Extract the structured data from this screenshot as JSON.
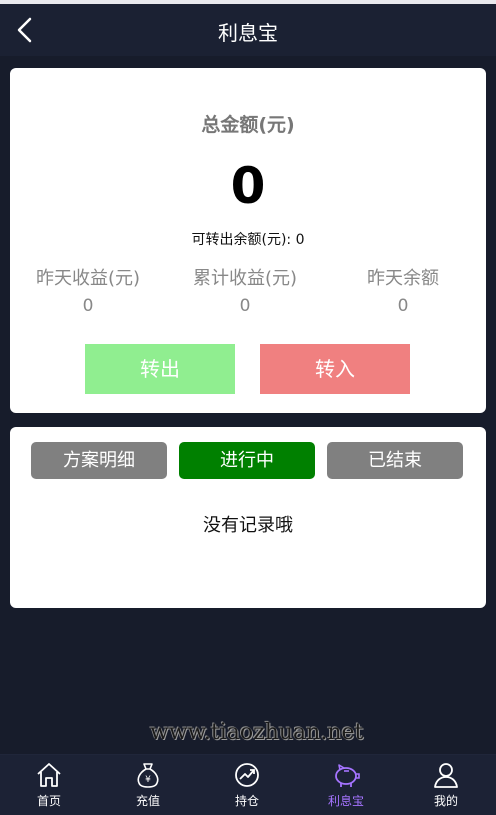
{
  "header": {
    "title": "利息宝"
  },
  "summary": {
    "total_label": "总金额(元)",
    "total_value": "0",
    "transferable_label": "可转出余额(元):",
    "transferable_value": "0",
    "stats": [
      {
        "label": "昨天收益(元)",
        "value": "0"
      },
      {
        "label": "累计收益(元)",
        "value": "0"
      },
      {
        "label": "昨天余额",
        "value": "0"
      }
    ],
    "transfer_out_label": "转出",
    "transfer_in_label": "转入"
  },
  "records": {
    "tabs": [
      {
        "label": "方案明细",
        "color": "#808080"
      },
      {
        "label": "进行中",
        "color": "#008000"
      },
      {
        "label": "已结束",
        "color": "#808080"
      }
    ],
    "empty_message": "没有记录哦"
  },
  "watermark": "www.tiaozhuan.net",
  "tabbar": {
    "items": [
      {
        "label": "首页",
        "icon": "home-icon"
      },
      {
        "label": "充值",
        "icon": "money-bag-icon"
      },
      {
        "label": "持仓",
        "icon": "chart-icon"
      },
      {
        "label": "利息宝",
        "icon": "piggy-bank-icon",
        "active": true
      },
      {
        "label": "我的",
        "icon": "user-icon"
      }
    ],
    "active_color": "#a574ff"
  }
}
